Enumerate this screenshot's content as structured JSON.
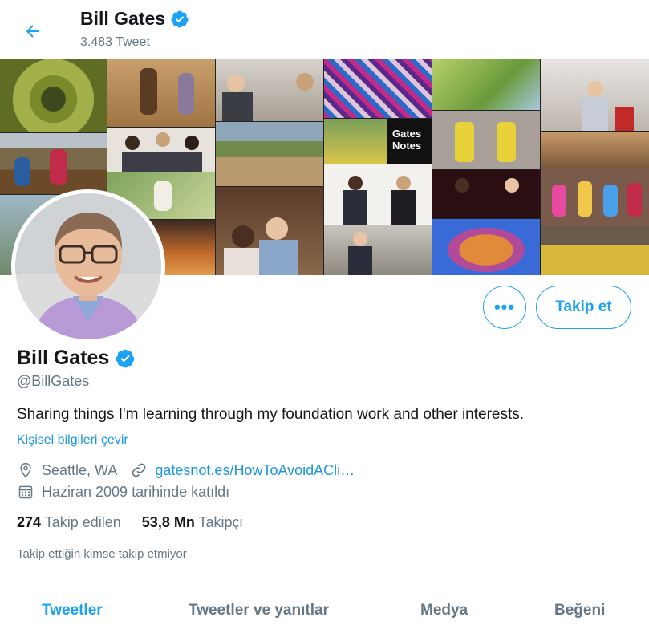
{
  "header": {
    "name": "Bill Gates",
    "tweet_count": "3.483 Tweet"
  },
  "banner": {
    "gates_notes_label_1": "Gates",
    "gates_notes_label_2": "Notes"
  },
  "profile": {
    "name": "Bill Gates",
    "handle": "@BillGates",
    "bio": "Sharing things I'm learning through my foundation work and other interests.",
    "translate_label": "Kişisel bilgileri çevir",
    "location": "Seattle, WA",
    "website": "gatesnot.es/HowToAvoidACli…",
    "joined": "Haziran 2009 tarihinde katıldı",
    "following_count": "274",
    "following_label": "Takip edilen",
    "followers_count": "53,8 Mn",
    "followers_label": "Takipçi",
    "followed_by_note": "Takip ettiğin kimse takip etmiyor"
  },
  "actions": {
    "more_label": "•••",
    "follow_label": "Takip et"
  },
  "tabs": [
    {
      "label": "Tweetler",
      "active": true
    },
    {
      "label": "Tweetler ve yanıtlar",
      "active": false
    },
    {
      "label": "Medya",
      "active": false
    },
    {
      "label": "Beğeni",
      "active": false
    }
  ],
  "colors": {
    "accent": "#1da1f2",
    "link": "#1b95e0",
    "muted": "#657786",
    "text": "#14171a"
  }
}
